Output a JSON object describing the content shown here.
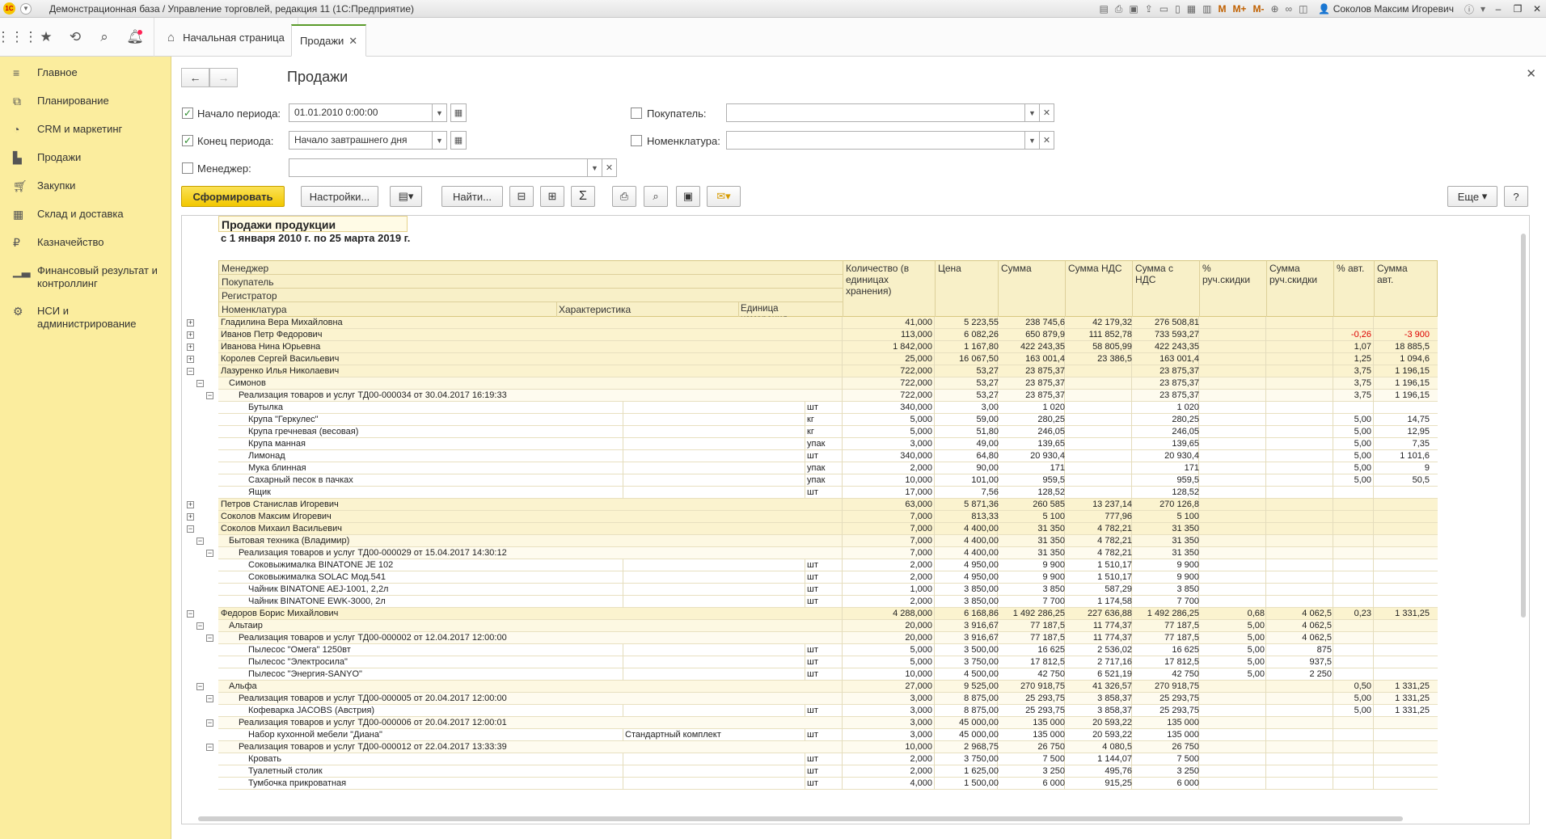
{
  "window": {
    "title": "Демонстрационная база / Управление торговлей, редакция 11  (1С:Предприятие)",
    "user": "Соколов Максим Игоревич",
    "tool_icons": [
      "M",
      "M+",
      "M-"
    ]
  },
  "tabs": {
    "home": "Начальная страница",
    "sales": "Продажи"
  },
  "sidebar": {
    "items": [
      {
        "label": "Главное",
        "icon": "menu-icon"
      },
      {
        "label": "Планирование",
        "icon": "planning-icon"
      },
      {
        "label": "CRM и маркетинг",
        "icon": "crm-icon"
      },
      {
        "label": "Продажи",
        "icon": "bag-icon"
      },
      {
        "label": "Закупки",
        "icon": "cart-icon"
      },
      {
        "label": "Склад и доставка",
        "icon": "warehouse-icon"
      },
      {
        "label": "Казначейство",
        "icon": "ruble-icon"
      },
      {
        "label": "Финансовый результат и контроллинг",
        "icon": "chart-icon"
      },
      {
        "label": "НСИ и администрирование",
        "icon": "gear-icon"
      }
    ]
  },
  "form": {
    "title": "Продажи",
    "period_start_label": "Начало периода:",
    "period_start_value": "01.01.2010  0:00:00",
    "period_end_label": "Конец периода:",
    "period_end_value": "Начало завтрашнего дня",
    "manager_label": "Менеджер:",
    "manager_value": "",
    "buyer_label": "Покупатель:",
    "buyer_value": "",
    "nomenclature_label": "Номенклатура:",
    "nomenclature_value": ""
  },
  "toolbar": {
    "generate": "Сформировать",
    "settings": "Настройки...",
    "find": "Найти...",
    "more": "Еще",
    "help": "?"
  },
  "report": {
    "title": "Продажи продукции",
    "period": "с 1 января 2010 г. по 25 марта 2019 г.",
    "headers": {
      "manager": "Менеджер",
      "buyer": "Покупатель",
      "registrar": "Регистратор",
      "nomenclature": "Номенклатура",
      "characteristic": "Характеристика",
      "unit": "Единица измерения",
      "qty": "Количество (в единицах хранения)",
      "price": "Цена",
      "sum": "Сумма",
      "vat": "Сумма НДС",
      "sum_vat": "Сумма с НДС",
      "pct_disc": "% руч.скидки",
      "sum_disc": "Сумма руч.скидки",
      "pct_auto": "% авт.",
      "sum_auto": "Сумма авт."
    },
    "rows": [
      {
        "lvl": 0,
        "tg": "+",
        "name": "Гладилина Вера Михайловна",
        "qty": "41,000",
        "price": "5 223,55",
        "sum": "238 745,6",
        "vat": "42 179,32",
        "sv": "276 508,81"
      },
      {
        "lvl": 0,
        "tg": "+",
        "name": "Иванов Петр Федорович",
        "qty": "113,000",
        "price": "6 082,26",
        "sum": "650 879,9",
        "vat": "111 852,78",
        "sv": "733 593,27",
        "pa": "-0,26",
        "sa": "-3 900"
      },
      {
        "lvl": 0,
        "tg": "+",
        "name": "Иванова Нина Юрьевна",
        "qty": "1 842,000",
        "price": "1 167,80",
        "sum": "422 243,35",
        "vat": "58 805,99",
        "sv": "422 243,35",
        "pa": "1,07",
        "sa": "18 885,5"
      },
      {
        "lvl": 0,
        "tg": "+",
        "name": "Королев Сергей Васильевич",
        "qty": "25,000",
        "price": "16 067,50",
        "sum": "163 001,4",
        "vat": "23 386,5",
        "sv": "163 001,4",
        "pa": "1,25",
        "sa": "1 094,6"
      },
      {
        "lvl": 0,
        "tg": "-",
        "name": "Лазуренко Илья Николаевич",
        "qty": "722,000",
        "price": "53,27",
        "sum": "23 875,37",
        "sv": "23 875,37",
        "pa": "3,75",
        "sa": "1 196,15"
      },
      {
        "lvl": 1,
        "tg": "-",
        "name": "Симонов",
        "qty": "722,000",
        "price": "53,27",
        "sum": "23 875,37",
        "sv": "23 875,37",
        "pa": "3,75",
        "sa": "1 196,15"
      },
      {
        "lvl": 2,
        "tg": "-",
        "name": "Реализация товаров и услуг ТД00-000034 от 30.04.2017 16:19:33",
        "qty": "722,000",
        "price": "53,27",
        "sum": "23 875,37",
        "sv": "23 875,37",
        "pa": "3,75",
        "sa": "1 196,15"
      },
      {
        "lvl": 3,
        "name": "Бутылка",
        "unit": "шт",
        "qty": "340,000",
        "price": "3,00",
        "sum": "1 020",
        "sv": "1 020"
      },
      {
        "lvl": 3,
        "name": "Крупа \"Геркулес\"",
        "unit": "кг",
        "qty": "5,000",
        "price": "59,00",
        "sum": "280,25",
        "sv": "280,25",
        "pa": "5,00",
        "sa": "14,75"
      },
      {
        "lvl": 3,
        "name": "Крупа гречневая (весовая)",
        "unit": "кг",
        "qty": "5,000",
        "price": "51,80",
        "sum": "246,05",
        "sv": "246,05",
        "pa": "5,00",
        "sa": "12,95"
      },
      {
        "lvl": 3,
        "name": "Крупа манная",
        "unit": "упак",
        "qty": "3,000",
        "price": "49,00",
        "sum": "139,65",
        "sv": "139,65",
        "pa": "5,00",
        "sa": "7,35"
      },
      {
        "lvl": 3,
        "name": "Лимонад",
        "unit": "шт",
        "qty": "340,000",
        "price": "64,80",
        "sum": "20 930,4",
        "sv": "20 930,4",
        "pa": "5,00",
        "sa": "1 101,6"
      },
      {
        "lvl": 3,
        "name": "Мука блинная",
        "unit": "упак",
        "qty": "2,000",
        "price": "90,00",
        "sum": "171",
        "sv": "171",
        "pa": "5,00",
        "sa": "9"
      },
      {
        "lvl": 3,
        "name": "Сахарный песок в пачках",
        "unit": "упак",
        "qty": "10,000",
        "price": "101,00",
        "sum": "959,5",
        "sv": "959,5",
        "pa": "5,00",
        "sa": "50,5"
      },
      {
        "lvl": 3,
        "name": "Ящик",
        "unit": "шт",
        "qty": "17,000",
        "price": "7,56",
        "sum": "128,52",
        "sv": "128,52"
      },
      {
        "lvl": 0,
        "tg": "+",
        "name": "Петров Станислав Игоревич",
        "qty": "63,000",
        "price": "5 871,36",
        "sum": "260 585",
        "vat": "13 237,14",
        "sv": "270 126,8"
      },
      {
        "lvl": 0,
        "tg": "+",
        "name": "Соколов Максим Игоревич",
        "qty": "7,000",
        "price": "813,33",
        "sum": "5 100",
        "vat": "777,96",
        "sv": "5 100"
      },
      {
        "lvl": 0,
        "tg": "-",
        "name": "Соколов Михаил Васильевич",
        "qty": "7,000",
        "price": "4 400,00",
        "sum": "31 350",
        "vat": "4 782,21",
        "sv": "31 350"
      },
      {
        "lvl": 1,
        "tg": "-",
        "name": "Бытовая техника (Владимир)",
        "qty": "7,000",
        "price": "4 400,00",
        "sum": "31 350",
        "vat": "4 782,21",
        "sv": "31 350"
      },
      {
        "lvl": 2,
        "tg": "-",
        "name": "Реализация товаров и услуг ТД00-000029 от 15.04.2017 14:30:12",
        "qty": "7,000",
        "price": "4 400,00",
        "sum": "31 350",
        "vat": "4 782,21",
        "sv": "31 350"
      },
      {
        "lvl": 3,
        "name": "Соковыжималка  BINATONE JE 102",
        "unit": "шт",
        "qty": "2,000",
        "price": "4 950,00",
        "sum": "9 900",
        "vat": "1 510,17",
        "sv": "9 900"
      },
      {
        "lvl": 3,
        "name": "Соковыжималка  SOLAC  Мод.541",
        "unit": "шт",
        "qty": "2,000",
        "price": "4 950,00",
        "sum": "9 900",
        "vat": "1 510,17",
        "sv": "9 900"
      },
      {
        "lvl": 3,
        "name": "Чайник BINATONE  AEJ-1001,  2,2л",
        "unit": "шт",
        "qty": "1,000",
        "price": "3 850,00",
        "sum": "3 850",
        "vat": "587,29",
        "sv": "3 850"
      },
      {
        "lvl": 3,
        "name": "Чайник BINATONE  EWK-3000,  2л",
        "unit": "шт",
        "qty": "2,000",
        "price": "3 850,00",
        "sum": "7 700",
        "vat": "1 174,58",
        "sv": "7 700"
      },
      {
        "lvl": 0,
        "tg": "-",
        "name": "Федоров Борис Михайлович",
        "qty": "4 288,000",
        "price": "6 168,86",
        "sum": "1 492 286,25",
        "vat": "227 636,88",
        "sv": "1 492 286,25",
        "pd": "0,68",
        "sd": "4 062,5",
        "pa": "0,23",
        "sa": "1 331,25"
      },
      {
        "lvl": 1,
        "tg": "-",
        "name": "Альтаир",
        "qty": "20,000",
        "price": "3 916,67",
        "sum": "77 187,5",
        "vat": "11 774,37",
        "sv": "77 187,5",
        "pd": "5,00",
        "sd": "4 062,5"
      },
      {
        "lvl": 2,
        "tg": "-",
        "name": "Реализация товаров и услуг ТД00-000002 от 12.04.2017 12:00:00",
        "qty": "20,000",
        "price": "3 916,67",
        "sum": "77 187,5",
        "vat": "11 774,37",
        "sv": "77 187,5",
        "pd": "5,00",
        "sd": "4 062,5"
      },
      {
        "lvl": 3,
        "name": "Пылесос \"Омега\" 1250вт",
        "unit": "шт",
        "qty": "5,000",
        "price": "3 500,00",
        "sum": "16 625",
        "vat": "2 536,02",
        "sv": "16 625",
        "pd": "5,00",
        "sd": "875"
      },
      {
        "lvl": 3,
        "name": "Пылесос \"Электросила\"",
        "unit": "шт",
        "qty": "5,000",
        "price": "3 750,00",
        "sum": "17 812,5",
        "vat": "2 717,16",
        "sv": "17 812,5",
        "pd": "5,00",
        "sd": "937,5"
      },
      {
        "lvl": 3,
        "name": "Пылесос \"Энергия-SANYO\"",
        "unit": "шт",
        "qty": "10,000",
        "price": "4 500,00",
        "sum": "42 750",
        "vat": "6 521,19",
        "sv": "42 750",
        "pd": "5,00",
        "sd": "2 250"
      },
      {
        "lvl": 1,
        "tg": "-",
        "name": "Альфа",
        "qty": "27,000",
        "price": "9 525,00",
        "sum": "270 918,75",
        "vat": "41 326,57",
        "sv": "270 918,75",
        "pa": "0,50",
        "sa": "1 331,25"
      },
      {
        "lvl": 2,
        "tg": "-",
        "name": "Реализация товаров и услуг ТД00-000005 от 20.04.2017 12:00:00",
        "qty": "3,000",
        "price": "8 875,00",
        "sum": "25 293,75",
        "vat": "3 858,37",
        "sv": "25 293,75",
        "pa": "5,00",
        "sa": "1 331,25"
      },
      {
        "lvl": 3,
        "name": "Кофеварка JACOBS (Австрия)",
        "unit": "шт",
        "qty": "3,000",
        "price": "8 875,00",
        "sum": "25 293,75",
        "vat": "3 858,37",
        "sv": "25 293,75",
        "pa": "5,00",
        "sa": "1 331,25"
      },
      {
        "lvl": 2,
        "tg": "-",
        "name": "Реализация товаров и услуг ТД00-000006 от 20.04.2017 12:00:01",
        "qty": "3,000",
        "price": "45 000,00",
        "sum": "135 000",
        "vat": "20 593,22",
        "sv": "135 000"
      },
      {
        "lvl": 3,
        "name": "Набор кухонной мебели \"Диана\"",
        "char": "Стандартный комплект",
        "unit": "шт",
        "qty": "3,000",
        "price": "45 000,00",
        "sum": "135 000",
        "vat": "20 593,22",
        "sv": "135 000"
      },
      {
        "lvl": 2,
        "tg": "-",
        "name": "Реализация товаров и услуг ТД00-000012 от 22.04.2017 13:33:39",
        "qty": "10,000",
        "price": "2 968,75",
        "sum": "26 750",
        "vat": "4 080,5",
        "sv": "26 750"
      },
      {
        "lvl": 3,
        "name": "Кровать",
        "unit": "шт",
        "qty": "2,000",
        "price": "3 750,00",
        "sum": "7 500",
        "vat": "1 144,07",
        "sv": "7 500"
      },
      {
        "lvl": 3,
        "name": "Туалетный столик",
        "unit": "шт",
        "qty": "2,000",
        "price": "1 625,00",
        "sum": "3 250",
        "vat": "495,76",
        "sv": "3 250"
      },
      {
        "lvl": 3,
        "name": "Тумбочка прикроватная",
        "unit": "шт",
        "qty": "4,000",
        "price": "1 500,00",
        "sum": "6 000",
        "vat": "915,25",
        "sv": "6 000"
      }
    ]
  }
}
